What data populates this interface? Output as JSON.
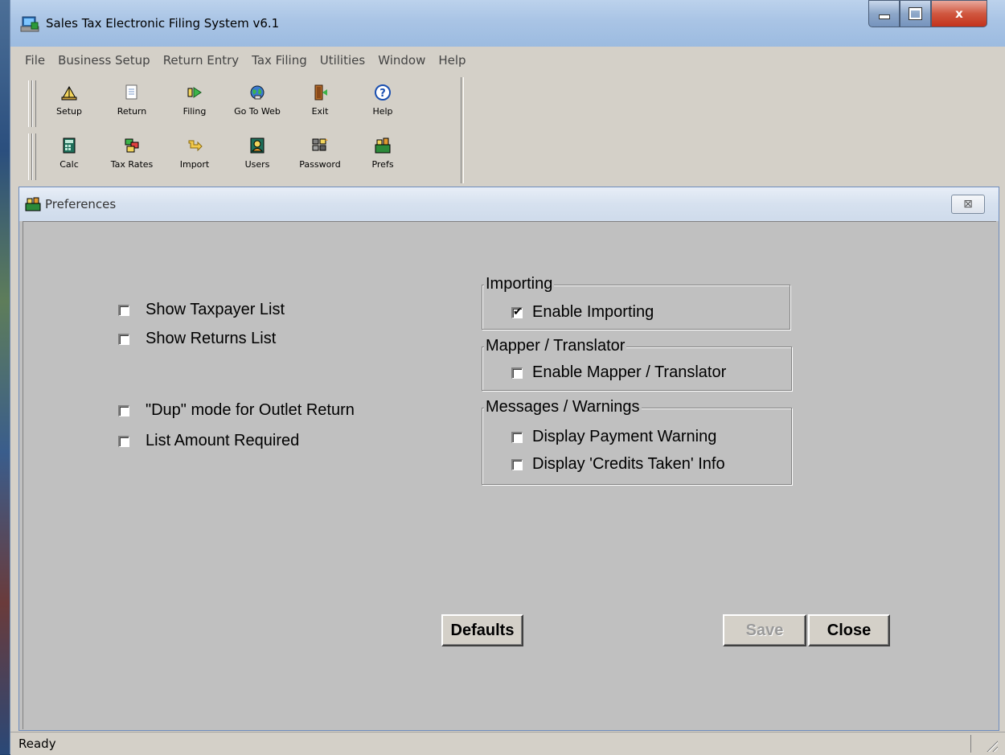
{
  "window": {
    "title": "Sales Tax Electronic Filing System v6.1",
    "controls": {
      "minimize": "minimize",
      "maximize": "maximize",
      "close": "x"
    }
  },
  "menu": [
    "File",
    "Business Setup",
    "Return Entry",
    "Tax Filing",
    "Utilities",
    "Window",
    "Help"
  ],
  "toolbar1": [
    {
      "label": "Setup",
      "icon": "setup-icon"
    },
    {
      "label": "Return",
      "icon": "return-icon"
    },
    {
      "label": "Filing",
      "icon": "filing-icon"
    },
    {
      "label": "Go To Web",
      "icon": "globe-icon"
    },
    {
      "label": "Exit",
      "icon": "exit-door-icon"
    },
    {
      "label": "Help",
      "icon": "help-icon"
    }
  ],
  "toolbar2": [
    {
      "label": "Calc",
      "icon": "calculator-icon"
    },
    {
      "label": "Tax Rates",
      "icon": "tax-rates-icon"
    },
    {
      "label": "Import",
      "icon": "import-icon"
    },
    {
      "label": "Users",
      "icon": "users-icon"
    },
    {
      "label": "Password",
      "icon": "password-icon"
    },
    {
      "label": "Prefs",
      "icon": "prefs-icon"
    }
  ],
  "prefs": {
    "title": "Preferences",
    "close_glyph": "⊠",
    "options": [
      {
        "label": "Show Taxpayer List",
        "checked": false
      },
      {
        "label": "Show Returns List",
        "checked": false
      },
      {
        "label": "\"Dup\" mode for Outlet Return",
        "checked": false
      },
      {
        "label": "List Amount Required",
        "checked": false
      }
    ],
    "groups": {
      "importing": {
        "label": "Importing",
        "items": [
          {
            "label": "Enable Importing",
            "checked": true
          }
        ]
      },
      "mapper": {
        "label": "Mapper / Translator",
        "items": [
          {
            "label": "Enable Mapper / Translator",
            "checked": false
          }
        ]
      },
      "messages": {
        "label": "Messages / Warnings",
        "items": [
          {
            "label": "Display Payment Warning",
            "checked": false
          },
          {
            "label": "Display 'Credits Taken' Info",
            "checked": false
          }
        ]
      }
    },
    "buttons": {
      "defaults": "Defaults",
      "save": "Save",
      "close": "Close"
    }
  },
  "status": {
    "text": "Ready"
  }
}
